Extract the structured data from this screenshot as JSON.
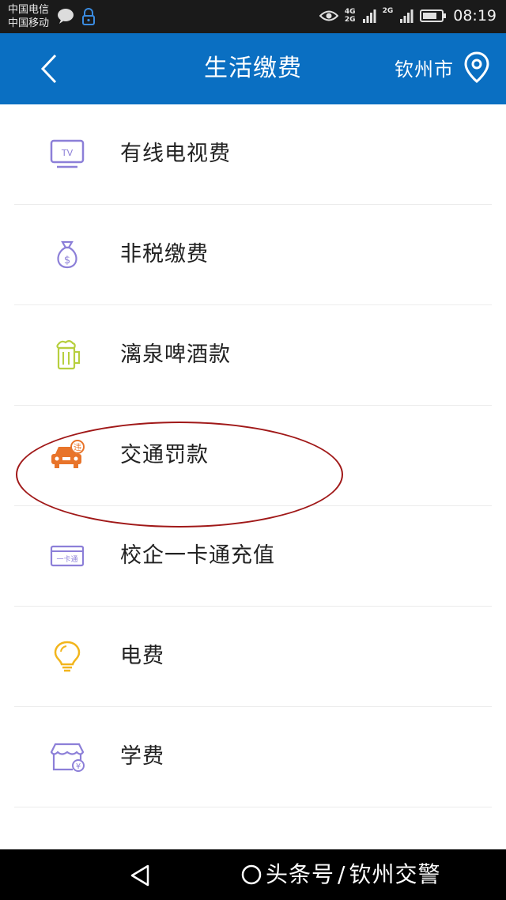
{
  "status_bar": {
    "carrier_1": "中国电信",
    "carrier_2": "中国移动",
    "net_1": "4G",
    "net_2": "2G",
    "net_3": "2G",
    "time": "08:19"
  },
  "nav": {
    "title": "生活缴费",
    "city": "钦州市"
  },
  "items": [
    {
      "label": "有线电视费",
      "icon": "tv-icon",
      "icon_text": "TV",
      "color": "#8c7fd8"
    },
    {
      "label": "非税缴费",
      "icon": "money-bag-icon",
      "icon_text": "$",
      "color": "#8c7fd8"
    },
    {
      "label": "漓泉啤酒款",
      "icon": "beer-icon",
      "color": "#b7cf3f"
    },
    {
      "label": "交通罚款",
      "icon": "car-fine-icon",
      "icon_text": "违",
      "color": "#e8742a"
    },
    {
      "label": "校企一卡通充值",
      "icon": "card-icon",
      "icon_text": "一卡通",
      "color": "#8c7fd8"
    },
    {
      "label": "电费",
      "icon": "lightbulb-icon",
      "color": "#f2b51c"
    },
    {
      "label": "学费",
      "icon": "school-store-icon",
      "icon_text": "¥",
      "color": "#8c7fd8"
    }
  ],
  "watermark": {
    "text": "头条号",
    "separator": "/",
    "account": "钦州交警"
  },
  "colors": {
    "nav_bg": "#0a6fc2",
    "status_bg": "#1a1a1a",
    "highlight": "#a01818"
  }
}
